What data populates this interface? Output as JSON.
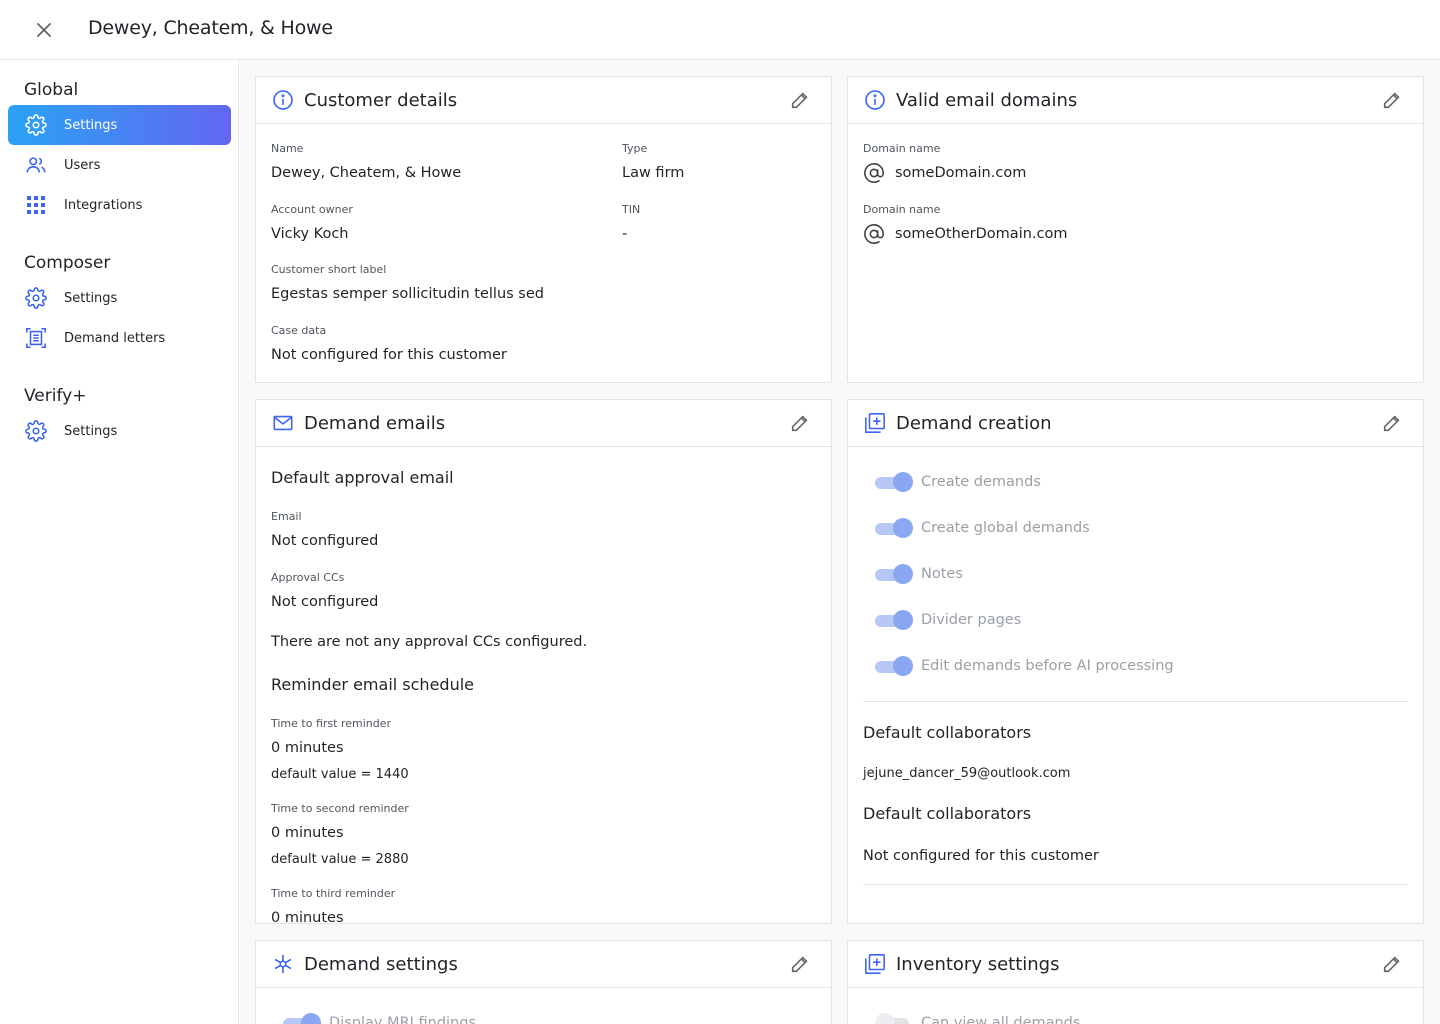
{
  "header": {
    "title": "Dewey, Cheatem, & Howe"
  },
  "sidebar": {
    "global_title": "Global",
    "global_items": [
      {
        "label": "Settings",
        "icon": "gear-icon"
      },
      {
        "label": "Users",
        "icon": "users-icon"
      },
      {
        "label": "Integrations",
        "icon": "grid-icon"
      }
    ],
    "composer_title": "Composer",
    "composer_items": [
      {
        "label": "Settings",
        "icon": "gear-icon"
      },
      {
        "label": "Demand letters",
        "icon": "document-icon"
      }
    ],
    "verify_title": "Verify+",
    "verify_items": [
      {
        "label": "Settings",
        "icon": "gear-icon"
      }
    ]
  },
  "customer_details": {
    "title": "Customer details",
    "name_label": "Name",
    "name_value": "Dewey, Cheatem, & Howe",
    "type_label": "Type",
    "type_value": "Law firm",
    "owner_label": "Account owner",
    "owner_value": "Vicky Koch",
    "tin_label": "TIN",
    "tin_value": "-",
    "short_label_label": "Customer short label",
    "short_label_value": "Egestas semper sollicitudin tellus sed",
    "case_data_label": "Case data",
    "case_data_value": "Not configured for this customer"
  },
  "valid_email_domains": {
    "title": "Valid email domains",
    "domains": [
      {
        "label": "Domain name",
        "value": "someDomain.com"
      },
      {
        "label": "Domain name",
        "value": "someOtherDomain.com"
      }
    ]
  },
  "demand_emails": {
    "title": "Demand emails",
    "approval_heading": "Default approval email",
    "email_label": "Email",
    "email_value": "Not configured",
    "ccs_label": "Approval CCs",
    "ccs_value": "Not configured",
    "ccs_note": "There are not any approval CCs configured.",
    "reminder_heading": "Reminder email schedule",
    "first_label": "Time to first reminder",
    "first_value": "0 minutes",
    "first_default": "default value = 1440",
    "second_label": "Time to second reminder",
    "second_value": "0 minutes",
    "second_default": "default value = 2880",
    "third_label": "Time to third reminder",
    "third_value": "0 minutes"
  },
  "demand_creation": {
    "title": "Demand creation",
    "toggles": [
      {
        "label": "Create demands",
        "on": true
      },
      {
        "label": "Create global demands",
        "on": true
      },
      {
        "label": "Notes",
        "on": true
      },
      {
        "label": "Divider pages",
        "on": true
      },
      {
        "label": "Edit demands before AI processing",
        "on": true
      }
    ],
    "collab_heading_1": "Default collaborators",
    "collab_value_1": "jejune_dancer_59@outlook.com",
    "collab_heading_2": "Default collaborators",
    "collab_value_2": "Not configured for this customer"
  },
  "demand_settings": {
    "title": "Demand settings",
    "toggle_label": "Display MRI findings",
    "toggle_on": true
  },
  "inventory_settings": {
    "title": "Inventory settings",
    "toggle_label": "Can view all demands",
    "toggle_on": false
  },
  "colors": {
    "accent": "#3b63f5",
    "gradient_start": "#2aa3f5",
    "gradient_end": "#6366f1"
  }
}
